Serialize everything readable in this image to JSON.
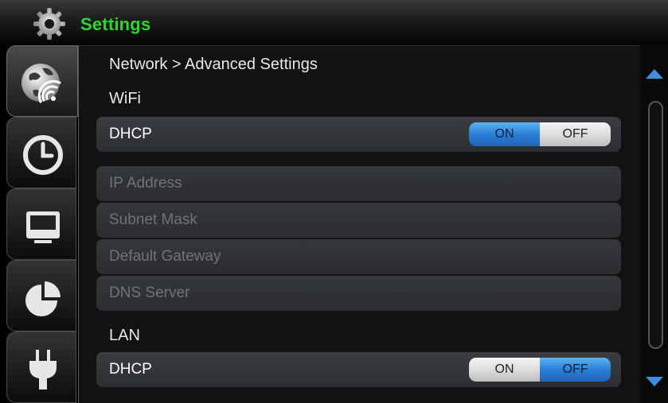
{
  "app": {
    "title": "Settings",
    "icon": "gear-icon"
  },
  "tabs": [
    {
      "name": "network",
      "icon": "globe-wifi-icon",
      "active": true
    },
    {
      "name": "clock",
      "icon": "clock-icon",
      "active": false
    },
    {
      "name": "display",
      "icon": "monitor-icon",
      "active": false
    },
    {
      "name": "storage",
      "icon": "pie-chart-icon",
      "active": false
    },
    {
      "name": "power",
      "icon": "plug-icon",
      "active": false
    }
  ],
  "breadcrumb": "Network > Advanced Settings",
  "wifi": {
    "section_label": "WiFi",
    "dhcp": {
      "label": "DHCP",
      "on_label": "ON",
      "off_label": "OFF",
      "value": "ON"
    },
    "fields": [
      {
        "label": "IP Address"
      },
      {
        "label": "Subnet Mask"
      },
      {
        "label": "Default Gateway"
      },
      {
        "label": "DNS Server"
      }
    ]
  },
  "lan": {
    "section_label": "LAN",
    "dhcp": {
      "label": "DHCP",
      "on_label": "ON",
      "off_label": "OFF",
      "value": "OFF"
    }
  },
  "colors": {
    "accent": "#2b7fd6",
    "title_green": "#2fd52f"
  }
}
